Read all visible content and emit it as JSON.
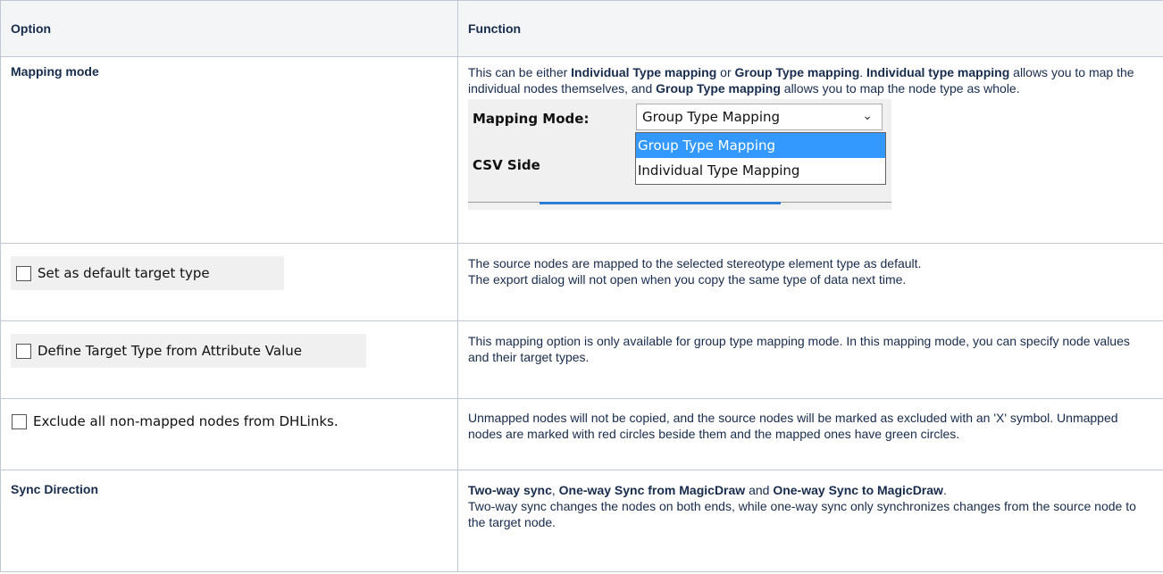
{
  "table": {
    "header": {
      "option": "Option",
      "function": "Function"
    },
    "row_mapping_mode": {
      "option": "Mapping mode",
      "desc_part1": "This can be either ",
      "desc_b1": "Individual Type mapping",
      "desc_part2": " or ",
      "desc_b2": "Group Type mapping",
      "desc_part3": ". ",
      "desc_b3": "Individual type mapping",
      "desc_part4": " allows you to map the individual nodes themselves, and ",
      "desc_b4": "Group Type mapping",
      "desc_part5": " allows you to map the node type as whole.",
      "screenshot": {
        "label": "Mapping Mode:",
        "selected": "Group Type Mapping",
        "options": [
          "Group Type Mapping",
          "Individual Type Mapping"
        ],
        "csv_label": "CSV Side",
        "chevron_icon": "chevron-down-icon"
      }
    },
    "row_default_target": {
      "checkbox_label": "Set as default target type",
      "checked": false,
      "desc_line1": "The source nodes are mapped to the selected stereotype element type as default.",
      "desc_line2": "The export dialog will not open when you copy the same type of data next time."
    },
    "row_define_target": {
      "checkbox_label": "Define Target Type from Attribute Value",
      "checked": false,
      "desc": "This mapping option is only available for group type mapping mode. In this mapping mode, you can specify node values and their target types."
    },
    "row_exclude": {
      "checkbox_label": "Exclude all non-mapped nodes from DHLinks.",
      "checked": false,
      "desc": "Unmapped nodes will not be copied, and the source nodes will be marked as excluded with an 'X' symbol. Unmapped nodes are marked with red circles beside them and the mapped ones have green circles."
    },
    "row_sync": {
      "option": "Sync Direction",
      "desc_b1": "Two-way sync",
      "desc_part1": ", ",
      "desc_b2": "One-way Sync from MagicDraw",
      "desc_part2": " and ",
      "desc_b3": "One-way Sync to MagicDraw",
      "desc_part3": ".",
      "desc_rest": "Two-way sync changes the nodes on both ends, while one-way sync only synchronizes changes from the source node to the target node."
    }
  },
  "colors": {
    "border": "#c1c7d0",
    "header_bg": "#f4f5f7",
    "text": "#172b4d",
    "selection": "#3399ff"
  }
}
